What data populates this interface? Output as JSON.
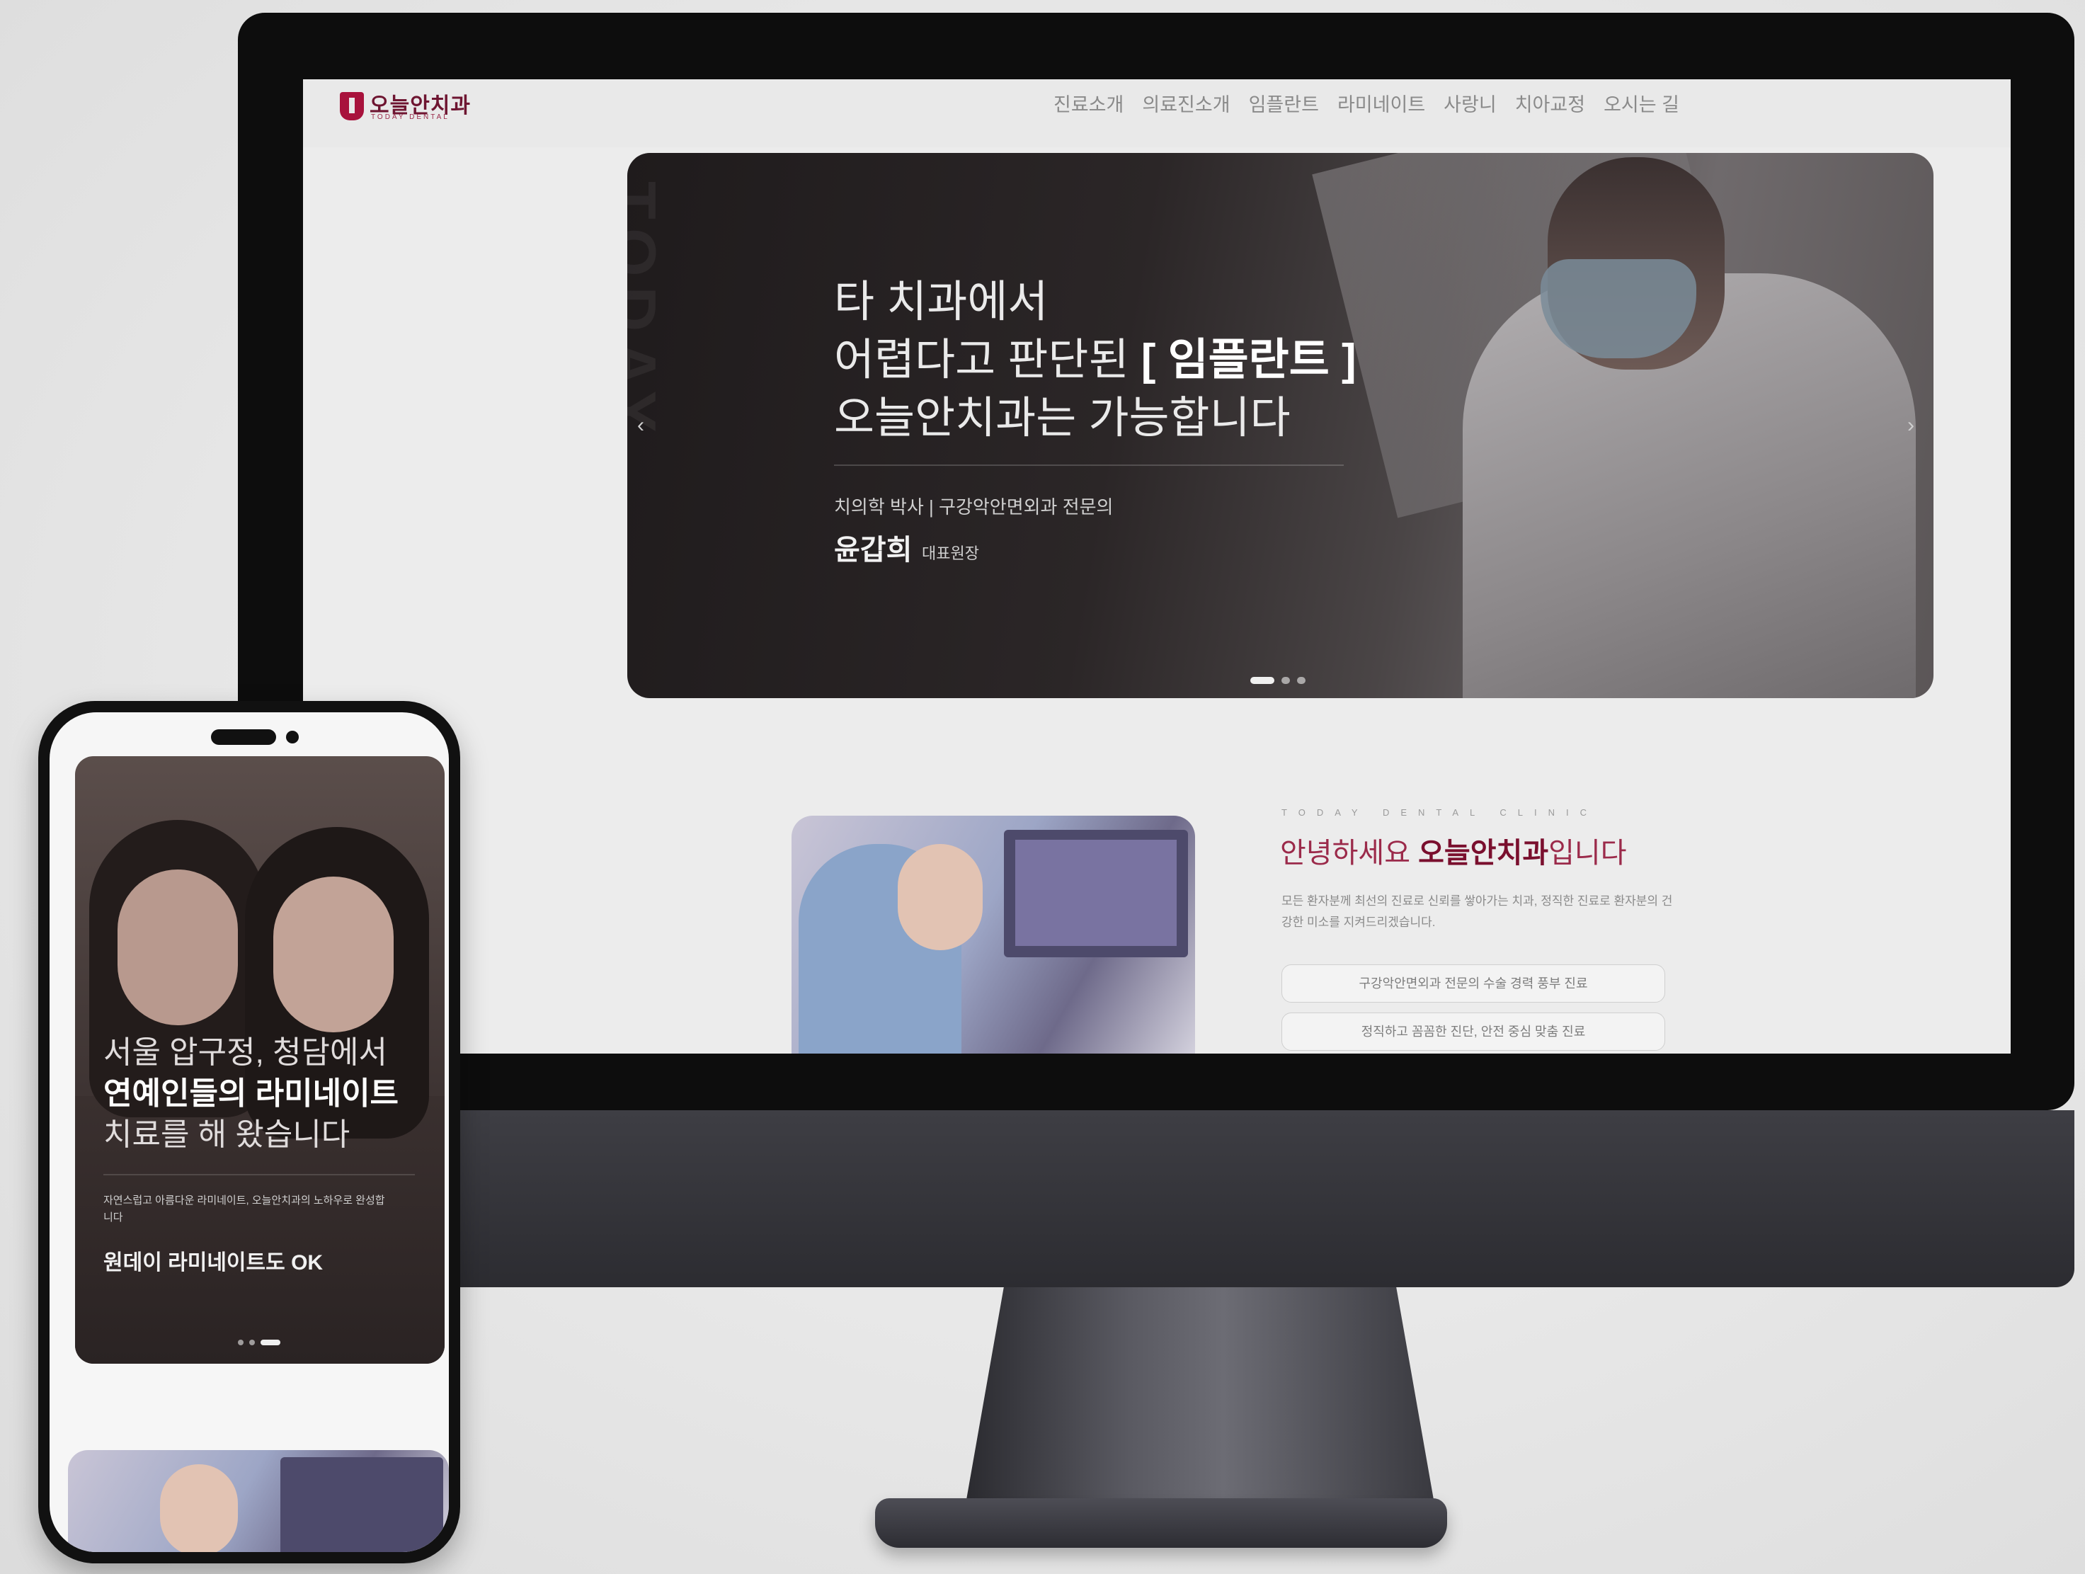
{
  "desktop": {
    "header": {
      "logo_text": "오늘안치과",
      "logo_sub": "TODAY DENTAL",
      "nav": [
        "진료소개",
        "의료진소개",
        "임플란트",
        "라미네이트",
        "사랑니",
        "치아교정",
        "오시는 길"
      ]
    },
    "hero": {
      "vertical_text": "TODAY DENTAL",
      "title_line1": "타 치과에서",
      "title_line2_pre": "어렵다고 판단된 ",
      "title_line2_em": "[ 임플란트 ]",
      "title_line3": "오늘안치과는 가능합니다",
      "credentials": "치의학 박사  |  구강악안면외과 전문의",
      "doctor_name": "윤갑희",
      "doctor_role": "대표원장",
      "prev_arrow": "‹",
      "next_arrow": "›",
      "slides_total": 3,
      "slide_active": 1
    },
    "intro": {
      "eyebrow": "TODAY DENTAL CLINIC",
      "title_pre": "안녕하세요 ",
      "title_em": "오늘안치과",
      "title_post": "입니다",
      "description": "모든 환자분께 최선의 진료로 신뢰를 쌓아가는 치과, 정직한 진료로 환자분의 건강한 미소를 지켜드리겠습니다.",
      "buttons": [
        "구강악안면외과 전문의 수술 경력 풍부 진료",
        "정직하고 꼼꼼한 진단, 안전 중심 맞춤 진료"
      ]
    }
  },
  "mobile": {
    "hero": {
      "title_line1": "서울 압구정, 청담에서",
      "title_line2": "연예인들의 라미네이트",
      "title_line3": "치료를 해 왔습니다",
      "description": "자연스럽고 아름다운 라미네이트, 오늘안치과의 노하우로 완성합니다",
      "subtitle": "원데이 라미네이트도 OK",
      "slides_total": 3,
      "slide_active": 3
    }
  }
}
